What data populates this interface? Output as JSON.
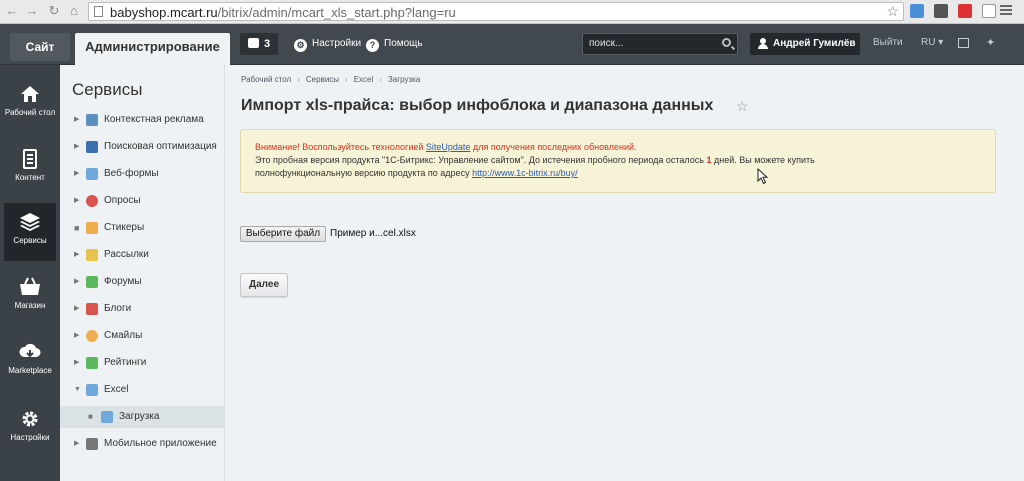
{
  "browser": {
    "url_host": "babyshop.mcart.ru",
    "url_path": "/bitrix/admin/mcart_xls_start.php?lang=ru"
  },
  "topbar": {
    "site_tab": "Сайт",
    "admin_tab": "Администрирование",
    "notifications_count": "3",
    "settings": "Настройки",
    "help": "Помощь",
    "search_placeholder": "поиск...",
    "user": "Андрей Гумилёв",
    "exit": "Выйти",
    "lang": "RU"
  },
  "rail": [
    {
      "label": "Рабочий стол",
      "icon": "home-icon"
    },
    {
      "label": "Контент",
      "icon": "document-icon"
    },
    {
      "label": "Сервисы",
      "icon": "layers-icon",
      "active": true
    },
    {
      "label": "Магазин",
      "icon": "basket-icon"
    },
    {
      "label": "Marketplace",
      "icon": "cloud-download-icon"
    },
    {
      "label": "Настройки",
      "icon": "gear-icon"
    }
  ],
  "panel": {
    "title": "Сервисы",
    "items": [
      {
        "label": "Контекстная реклама",
        "color": "#5a8fbf"
      },
      {
        "label": "Поисковая оптимизация",
        "color": "#3a6fb0"
      },
      {
        "label": "Веб-формы",
        "color": "#6fa8dc"
      },
      {
        "label": "Опросы",
        "color": "#d9534f"
      },
      {
        "label": "Стикеры",
        "color": "#f0ad4e"
      },
      {
        "label": "Рассылки",
        "color": "#e6c34a"
      },
      {
        "label": "Форумы",
        "color": "#5cb85c"
      },
      {
        "label": "Блоги",
        "color": "#d9534f"
      },
      {
        "label": "Смайлы",
        "color": "#f0ad4e"
      },
      {
        "label": "Рейтинги",
        "color": "#5cb85c"
      },
      {
        "label": "Excel",
        "color": "#6fa8dc"
      },
      {
        "label": "Загрузка",
        "color": "#6fa8dc"
      },
      {
        "label": "Мобильное приложение",
        "color": "#777777"
      }
    ]
  },
  "main": {
    "breadcrumbs": [
      "Рабочий стол",
      "Сервисы",
      "Excel",
      "Загрузка"
    ],
    "title": "Импорт xls-прайса: выбор инфоблока и диапазона данных",
    "alert": {
      "line1_pre": "Внимание! Воспользуйтесь технологией ",
      "line1_link": "SiteUpdate",
      "line1_post": " для получения последних обновлений.",
      "line2_pre": "Это пробная версия продукта \"1С-Битрикс: Управление сайтом\". До истечения пробного периода осталось ",
      "line2_days": "1",
      "line2_post": " дней. Вы можете купить",
      "line3_pre": "полнофункциональную версию продукта по адресу ",
      "line3_link": "http://www.1c-bitrix.ru/buy/"
    },
    "file_button": "Выберите файл",
    "file_name": "Пример и...cel.xlsx",
    "next_button": "Далее"
  }
}
